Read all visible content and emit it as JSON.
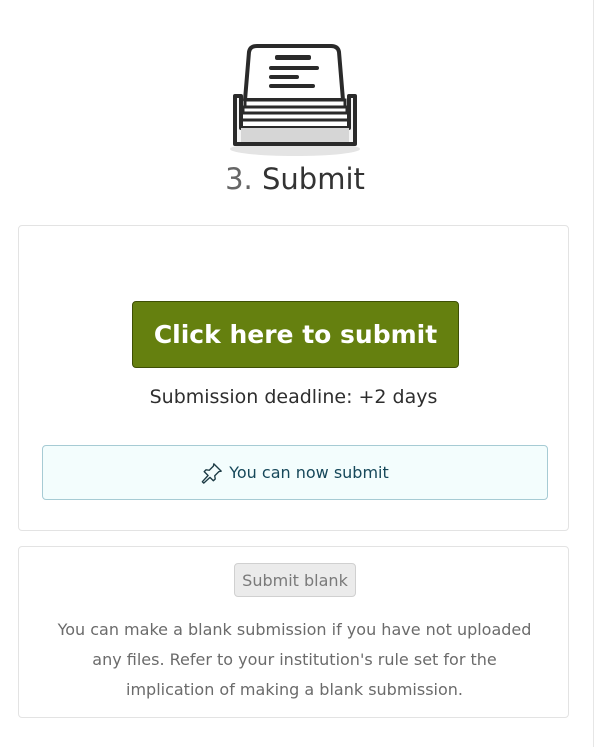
{
  "step": {
    "number": "3.",
    "title": "Submit",
    "icon": "document-tray-icon"
  },
  "submit_card": {
    "submit_button_label": "Click here to submit",
    "deadline_text": "Submission deadline: +2 days",
    "notice_icon": "pin-icon",
    "notice_text": "You can now submit"
  },
  "blank_card": {
    "button_label": "Submit blank",
    "note": "You can make a blank submission if you have not uploaded any files. Refer to your institution's rule set for the implication of making a blank submission."
  },
  "colors": {
    "primary_button": "#65800f",
    "notice_background": "#f3fdfd",
    "notice_border": "#a6cbd4",
    "notice_text": "#16485a"
  }
}
